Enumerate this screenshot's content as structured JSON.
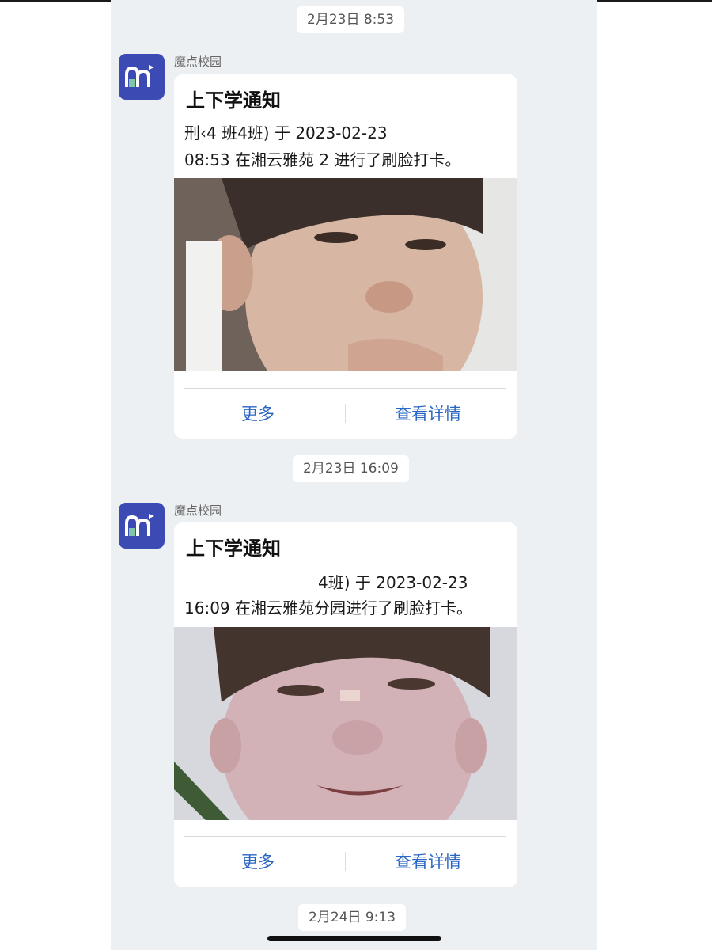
{
  "timestamps": [
    "2月23日 8:53",
    "2月23日 16:09",
    "2月24日 9:13"
  ],
  "messages": [
    {
      "sender": "魔点校园",
      "avatar_icon": "modian-app-logo-icon",
      "card": {
        "title": "上下学通知",
        "line1": "刑‹4 班4班) 于 2023-02-23",
        "line2": "08:53 在湘云雅苑 2 进行了刷脸打卡。",
        "photo_icon": "face-scan-photo",
        "more_label": "更多",
        "detail_label": "查看详情"
      }
    },
    {
      "sender": "魔点校园",
      "avatar_icon": "modian-app-logo-icon",
      "card": {
        "title": "上下学通知",
        "line1": "4班) 于 2023-02-23",
        "line2": "16:09 在湘云雅苑分园进行了刷脸打卡。",
        "photo_icon": "face-scan-photo",
        "more_label": "更多",
        "detail_label": "查看详情"
      }
    }
  ],
  "colors": {
    "chat_background": "#edf0f3",
    "card_background": "#ffffff",
    "action_text": "#2a66c4",
    "avatar_background": "#3c4ab4"
  }
}
